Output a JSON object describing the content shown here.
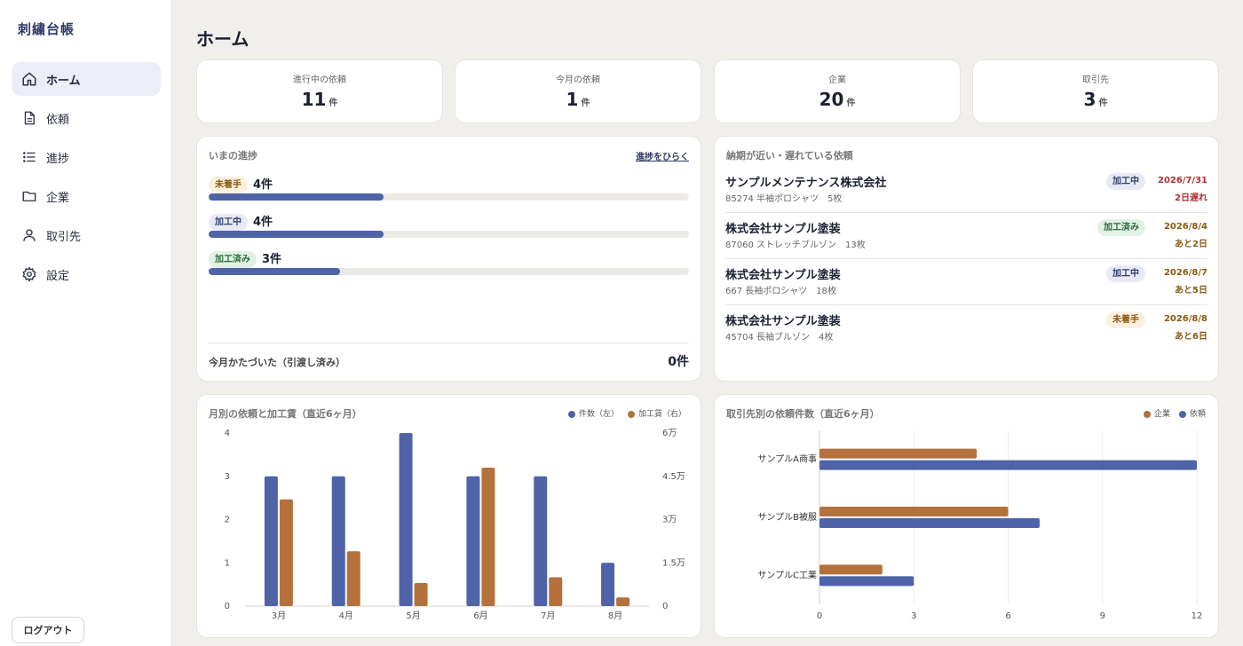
{
  "app": {
    "brand": "刺繍台帳",
    "page_title": "ホーム",
    "logout_label": "ログアウト"
  },
  "sidebar": {
    "items": [
      {
        "label": "ホーム",
        "icon": "home-icon",
        "active": true
      },
      {
        "label": "依頼",
        "icon": "document-icon",
        "active": false
      },
      {
        "label": "進捗",
        "icon": "list-icon",
        "active": false
      },
      {
        "label": "企業",
        "icon": "folder-icon",
        "active": false
      },
      {
        "label": "取引先",
        "icon": "user-icon",
        "active": false
      },
      {
        "label": "設定",
        "icon": "gear-icon",
        "active": false
      }
    ]
  },
  "stats": [
    {
      "label": "進行中の依頼",
      "value": "11",
      "unit": "件"
    },
    {
      "label": "今月の依頼",
      "value": "1",
      "unit": "件"
    },
    {
      "label": "企業",
      "value": "20",
      "unit": "件"
    },
    {
      "label": "取引先",
      "value": "3",
      "unit": "件"
    }
  ],
  "progress": {
    "title": "いまの進捗",
    "link": "進捗をひらく",
    "rows": [
      {
        "status": "未着手",
        "count": "4件",
        "value": 4,
        "kind": "unstarted"
      },
      {
        "status": "加工中",
        "count": "4件",
        "value": 4,
        "kind": "working"
      },
      {
        "status": "加工済み",
        "count": "3件",
        "value": 3,
        "kind": "done"
      }
    ],
    "max": 11,
    "month_done_label": "今月かたづいた（引渡し済み）",
    "month_done_value": "0件"
  },
  "due": {
    "title": "納期が近い・遅れている依頼",
    "items": [
      {
        "company": "サンプルメンテナンス株式会社",
        "sub": "85274 半袖ポロシャツ　5枚",
        "status": "加工中",
        "kind": "working",
        "date": "2026/7/31",
        "remaining": "2日遅れ",
        "late": true
      },
      {
        "company": "株式会社サンプル塗装",
        "sub": "87060 ストレッチブルゾン　13枚",
        "status": "加工済み",
        "kind": "done",
        "date": "2026/8/4",
        "remaining": "あと2日",
        "late": false
      },
      {
        "company": "株式会社サンプル塗装",
        "sub": "667 長袖ポロシャツ　18枚",
        "status": "加工中",
        "kind": "working",
        "date": "2026/8/7",
        "remaining": "あと5日",
        "late": false
      },
      {
        "company": "株式会社サンプル塗装",
        "sub": "45704 長袖ブルゾン　4枚",
        "status": "未着手",
        "kind": "unstarted",
        "date": "2026/8/8",
        "remaining": "あと6日",
        "late": false
      }
    ]
  },
  "colors": {
    "blue": "#4e63a8",
    "brown": "#b4713b"
  },
  "chart_data": [
    {
      "type": "bar",
      "title": "月別の依頼と加工賃（直近6ヶ月）",
      "categories": [
        "3月",
        "4月",
        "5月",
        "6月",
        "7月",
        "8月"
      ],
      "series": [
        {
          "name": "件数（左）",
          "axis": "left",
          "color": "#4e63a8",
          "values": [
            3,
            3,
            4,
            3,
            3,
            1
          ]
        },
        {
          "name": "加工賃（右）",
          "axis": "right",
          "color": "#b4713b",
          "values": [
            37000,
            19000,
            8000,
            48000,
            10000,
            3000
          ]
        }
      ],
      "ylim_left": [
        0,
        4
      ],
      "yticks_left": [
        "0",
        "1",
        "2",
        "3",
        "4"
      ],
      "ylim_right": [
        0,
        60000
      ],
      "yticks_right": [
        "0",
        "1.5万",
        "3万",
        "4.5万",
        "6万"
      ],
      "legend": "top-right",
      "grid": false
    },
    {
      "type": "bar",
      "orientation": "horizontal",
      "title": "取引先別の依頼件数（直近6ヶ月）",
      "categories": [
        "サンプルA商事",
        "サンプルB被服",
        "サンプルC工業"
      ],
      "series": [
        {
          "name": "企業",
          "color": "#b4713b",
          "values": [
            5,
            6,
            2
          ]
        },
        {
          "name": "依頼",
          "color": "#4e63a8",
          "values": [
            12,
            7,
            3
          ]
        }
      ],
      "xlim": [
        0,
        12
      ],
      "xticks": [
        "0",
        "3",
        "6",
        "9",
        "12"
      ],
      "legend": "top-right",
      "grid": true
    }
  ]
}
